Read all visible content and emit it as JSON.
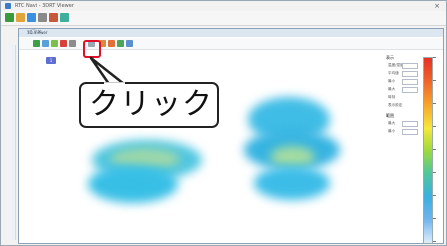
{
  "app": {
    "window_title": "RTC Navi - 3DRT Viewer",
    "close_glyph": "×"
  },
  "viewer": {
    "window_title": "3D Viewer",
    "controls": "– □ ×",
    "tag_label": "1"
  },
  "panel": {
    "section1": "表示",
    "labels": [
      "温度/湿度",
      "平均値",
      "最小",
      "最大",
      "時刻",
      "表示設定"
    ],
    "section2": "範囲",
    "labels2": [
      "最大",
      "最小"
    ]
  },
  "callout": {
    "text": "クリック"
  },
  "colors": {
    "highlight": "#e0102a",
    "blob_cyan": "#2ec4e8",
    "blob_green": "#7fd8a0",
    "blob_blue": "#3b8ee0"
  },
  "icons": {
    "main_toolbar": [
      "save-icon",
      "open-icon",
      "grid-icon",
      "edit-icon",
      "tools-icon",
      "help-icon"
    ],
    "viewer_toolbar": [
      "green-cube-icon",
      "layer-icon",
      "rotate-icon",
      "red-icon",
      "save-icon",
      "camera-icon",
      "settings-icon",
      "chart-icon",
      "grid-icon",
      "export-icon"
    ]
  }
}
